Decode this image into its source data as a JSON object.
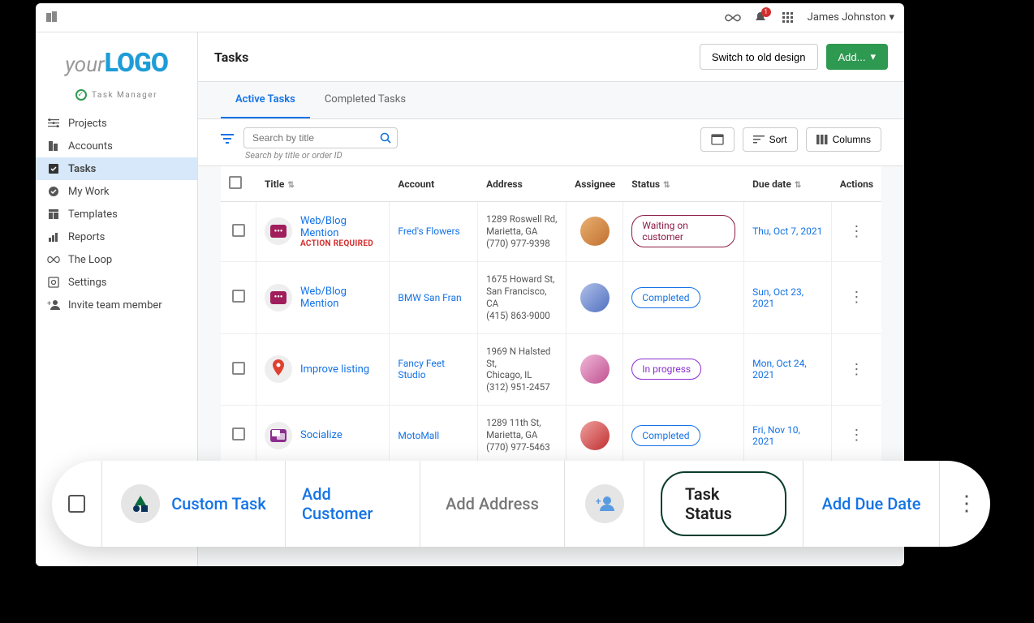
{
  "topbar": {
    "notification_count": "1",
    "user_name": "James Johnston"
  },
  "logo": {
    "part1": "your",
    "part2": "LOGO"
  },
  "task_manager_label": "Task Manager",
  "sidebar": {
    "items": [
      {
        "label": "Projects",
        "icon": "projects"
      },
      {
        "label": "Accounts",
        "icon": "accounts"
      },
      {
        "label": "Tasks",
        "icon": "tasks",
        "active": true
      },
      {
        "label": "My Work",
        "icon": "mywork"
      },
      {
        "label": "Templates",
        "icon": "templates"
      },
      {
        "label": "Reports",
        "icon": "reports"
      },
      {
        "label": "The Loop",
        "icon": "loop"
      },
      {
        "label": "Settings",
        "icon": "settings"
      },
      {
        "label": "Invite team member",
        "icon": "invite"
      }
    ]
  },
  "header": {
    "title": "Tasks",
    "switch_label": "Switch to old design",
    "add_label": "Add..."
  },
  "tabs": [
    {
      "label": "Active Tasks",
      "active": true
    },
    {
      "label": "Completed Tasks"
    }
  ],
  "search": {
    "placeholder": "Search by title",
    "hint": "Search by title or order ID"
  },
  "toolbar": {
    "sort_label": "Sort",
    "columns_label": "Columns"
  },
  "columns": {
    "title": "Title",
    "account": "Account",
    "address": "Address",
    "assignee": "Assignee",
    "status": "Status",
    "due": "Due date",
    "actions": "Actions"
  },
  "rows": [
    {
      "title": "Web/Blog Mention",
      "action_required": "ACTION REQUIRED",
      "icon": "chat",
      "account": "Fred's Flowers",
      "addr_l1": "1289 Roswell Rd,",
      "addr_l2": "Marietta, GA",
      "addr_l3": "(770) 977-9398",
      "status": "Waiting on customer",
      "status_class": "waiting",
      "due": "Thu, Oct 7, 2021"
    },
    {
      "title": "Web/Blog Mention",
      "icon": "chat",
      "account": "BMW San Fran",
      "addr_l1": "1675 Howard St,",
      "addr_l2": "San Francisco, CA",
      "addr_l3": "(415) 863-9000",
      "status": "Completed",
      "status_class": "completed",
      "due": "Sun, Oct 23, 2021"
    },
    {
      "title": "Improve listing",
      "icon": "pin",
      "account": "Fancy Feet Studio",
      "addr_l1": "1969 N Halsted St,",
      "addr_l2": "Chicago, IL",
      "addr_l3": "(312) 951-2457",
      "status": "In progress",
      "status_class": "progress",
      "due": "Mon, Oct 24, 2021"
    },
    {
      "title": "Socialize",
      "icon": "soc",
      "account": "MotoMall",
      "addr_l1": "1289 11th St,",
      "addr_l2": "Marietta, GA",
      "addr_l3": "(770) 977-5463",
      "status": "Completed",
      "status_class": "completed",
      "due": "Fri, Nov 10, 2021"
    }
  ],
  "float": {
    "custom_task": "Custom Task",
    "add_customer": "Add Customer",
    "add_address": "Add Address",
    "task_status": "Task Status",
    "add_due": "Add Due Date"
  }
}
